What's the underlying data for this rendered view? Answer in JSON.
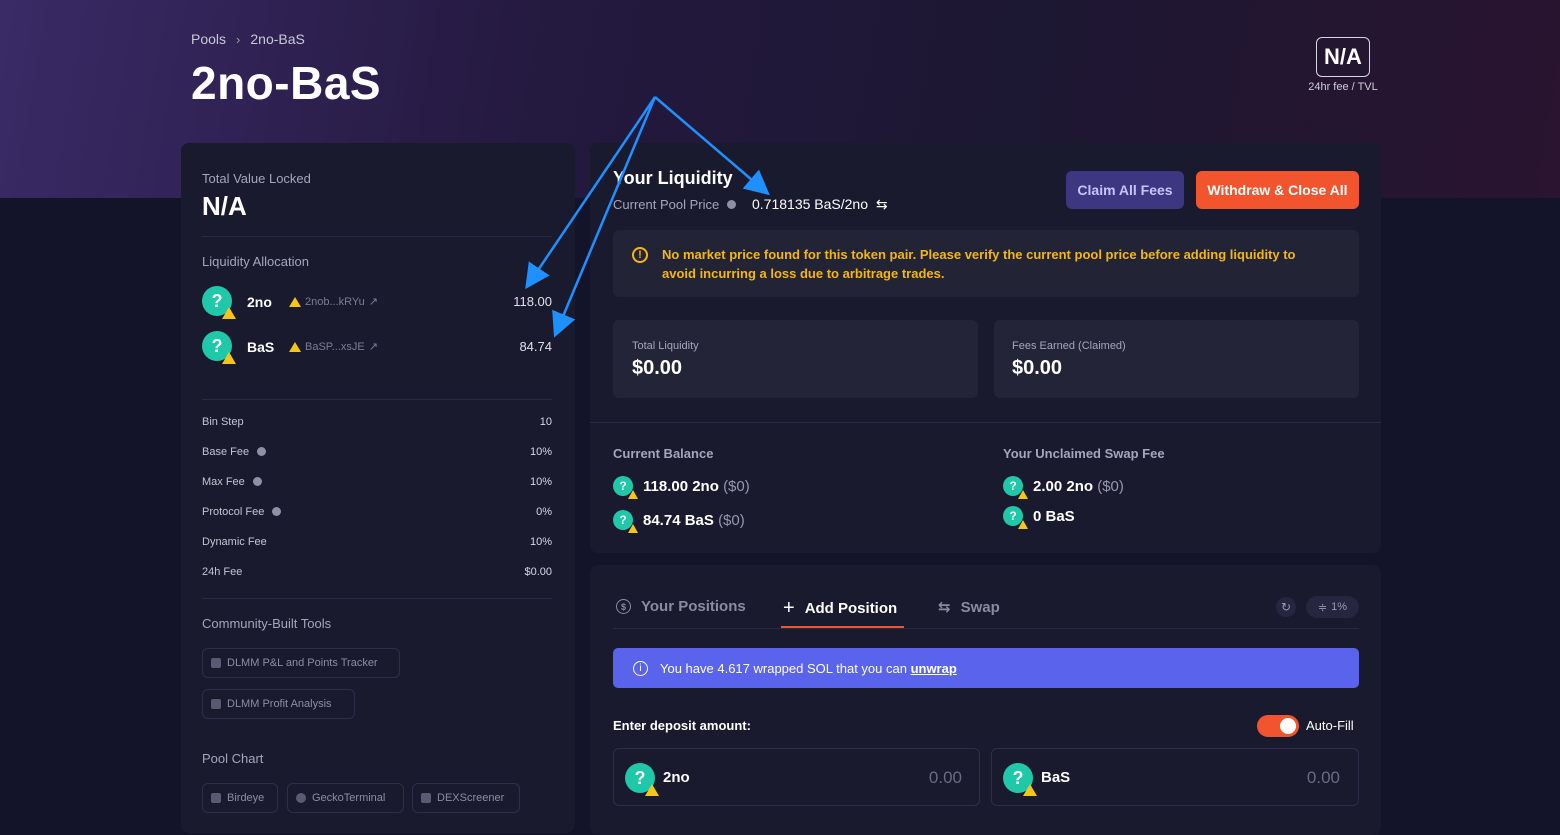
{
  "breadcrumb": {
    "root": "Pools",
    "separator": "›",
    "current": "2no-BaS"
  },
  "page_title": "2no-BaS",
  "fee_tvl": {
    "value": "N/A",
    "caption": "24hr fee / TVL"
  },
  "left": {
    "tvl_label": "Total Value Locked",
    "tvl_value": "N/A",
    "allocation_label": "Liquidity Allocation",
    "allocation": [
      {
        "symbol": "2no",
        "address": "2nob...kRYu",
        "amount": "118.00"
      },
      {
        "symbol": "BaS",
        "address": "BaSP...xsJE",
        "amount": "84.74"
      }
    ],
    "stats": [
      {
        "label": "Bin Step",
        "value": "10",
        "info": false
      },
      {
        "label": "Base Fee",
        "value": "10%",
        "info": true
      },
      {
        "label": "Max Fee",
        "value": "10%",
        "info": true
      },
      {
        "label": "Protocol Fee",
        "value": "0%",
        "info": true
      },
      {
        "label": "Dynamic Fee",
        "value": "10%",
        "info": false
      },
      {
        "label": "24h Fee",
        "value": "$0.00",
        "info": false
      }
    ],
    "tools_label": "Community-Built Tools",
    "tools": [
      "DLMM P&L and Points Tracker",
      "DLMM Profit Analysis"
    ],
    "chart_label": "Pool Chart",
    "charts": [
      "Birdeye",
      "GeckoTerminal",
      "DEXScreener"
    ]
  },
  "liquidity": {
    "title": "Your Liquidity",
    "pool_price_label": "Current Pool Price",
    "pool_price_value": "0.718135 BaS/2no",
    "claim_button": "Claim All Fees",
    "withdraw_button": "Withdraw & Close All",
    "warning": "No market price found for this token pair. Please verify the current pool price before adding liquidity to avoid incurring a loss due to arbitrage trades.",
    "total_liquidity_label": "Total Liquidity",
    "total_liquidity_value": "$0.00",
    "fees_earned_label": "Fees Earned (Claimed)",
    "fees_earned_value": "$0.00",
    "balance_label": "Current Balance",
    "balances": [
      {
        "amount": "118.00 2no",
        "usd": "($0)"
      },
      {
        "amount": "84.74 BaS",
        "usd": "($0)"
      }
    ],
    "unclaimed_label": "Your Unclaimed Swap Fee",
    "unclaimed": [
      {
        "amount": "2.00 2no",
        "usd": "($0)"
      },
      {
        "amount": "0 BaS",
        "usd": ""
      }
    ]
  },
  "positions": {
    "tabs": [
      "Your Positions",
      "Add Position",
      "Swap"
    ],
    "slippage": "1%",
    "banner_text": "You have 4.617 wrapped SOL that you can ",
    "banner_link": "unwrap",
    "deposit_label": "Enter deposit amount:",
    "autofill_label": "Auto-Fill",
    "inputs": [
      {
        "symbol": "2no",
        "value": "0.00"
      },
      {
        "symbol": "BaS",
        "value": "0.00"
      }
    ]
  },
  "colors": {
    "accent_orange": "#f2542d",
    "claim_purple": "#3d3680",
    "warning_yellow": "#f5b70f",
    "banner_blue": "#5a63ec",
    "token_teal": "#1ec8a8",
    "annotation_arrow": "#1e90ff"
  }
}
